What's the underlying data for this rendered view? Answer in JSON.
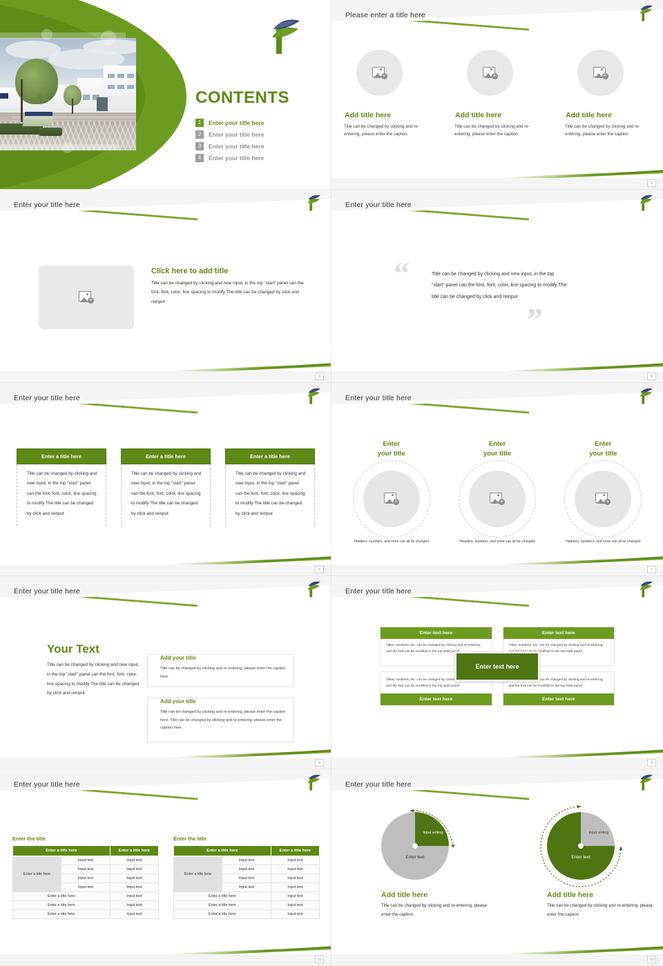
{
  "brand": {
    "green_dark": "#5d8a16",
    "green_mid": "#6c9c1f",
    "green_light": "#7aa72a",
    "navy": "#3c4a7a",
    "grey": "#c8c8c8",
    "logo_name": "leaf-sprout-logo"
  },
  "cover": {
    "title": "CONTENTS",
    "logo": "leaf-sprout-logo",
    "photo_alt": "campus-building-photo",
    "toc": [
      {
        "num": "1",
        "label": "Enter your title here",
        "active": true
      },
      {
        "num": "2",
        "label": "Enter your title here",
        "active": false
      },
      {
        "num": "3",
        "label": "Enter your title here",
        "active": false
      },
      {
        "num": "4",
        "label": "Enter your title here",
        "active": false
      }
    ]
  },
  "slide2": {
    "header_title": "Please enter a title here",
    "page_number": "5",
    "columns": [
      {
        "title": "Add title here",
        "body": "Title can be changed by clicking and re-entering, please enter the caption"
      },
      {
        "title": "Add title here",
        "body": "Title can be changed by clicking and re-entering, please enter the caption"
      },
      {
        "title": "Add title here",
        "body": "Title can be changed by clicking and re-entering, please enter the caption"
      }
    ]
  },
  "slide3": {
    "header_title": "Enter your title here",
    "page_number": "4",
    "title": "Click here to add title",
    "body": "Title can be changed by clicking and new input, in the top \"start\" panel can the font, font, color, line spacing to modify The title can be changed by click and reinput"
  },
  "slide4": {
    "header_title": "Enter your title here",
    "page_number": "5",
    "quote_open": "“",
    "quote_close": "”",
    "body": "Title can be changed by clicking and new input, in the top \"start\" panel can the font, font, color, line spacing to modify The title can be changed by click and reinput"
  },
  "slide5": {
    "header_title": "Enter your title here",
    "page_number": "6",
    "cards": [
      {
        "head": "Enter a title here",
        "body": "Title can be changed by clicking and new input, in the top \"start\" panel can the font, font, color, line spacing to modify The title can be changed by click and reinput"
      },
      {
        "head": "Enter a title here",
        "body": "Title can be changed by clicking and new input, in the top \"start\" panel can the font, font, color, line spacing to modify The title can be changed by click and reinput"
      },
      {
        "head": "Enter a title here",
        "body": "Title can be changed by clicking and new input, in the top \"start\" panel can the font, font, color, line spacing to modify The title can be changed by click and reinput"
      }
    ]
  },
  "slide6": {
    "header_title": "Enter your title here",
    "page_number": "7",
    "columns": [
      {
        "title_line1": "Enter",
        "title_line2": "your title",
        "caption": "Headers, numbers, and more can all be changed"
      },
      {
        "title_line1": "Enter",
        "title_line2": "your title",
        "caption": "Headers, numbers, and more can all be changed"
      },
      {
        "title_line1": "Enter",
        "title_line2": "your title",
        "caption": "Headers, numbers, and more can all be changed"
      }
    ]
  },
  "slide7": {
    "header_title": "Enter your title here",
    "page_number": "8",
    "left_title": "Your Text",
    "left_body": "Title can be changed by clicking and new input, in the top \"start\" panel can the font, font, color, line spacing to modify The title can be changed by click and reinput",
    "cards": [
      {
        "title": "Add your title",
        "body": "Title can be changed by clicking and re-entering, please enter the caption here."
      },
      {
        "title": "Add your title",
        "body": "Title can be changed by clicking and re-entering, please enter the caption here. Title can be changed by clicking and re-entering, please enter the caption here."
      }
    ]
  },
  "slide8": {
    "header_title": "Enter your title here",
    "page_number": "9",
    "center_label": "Enter text here",
    "quadrants": [
      {
        "head": "Enter text here",
        "body": "Titles, numbers, etc. can be changed by clicking and re-entering, and the font can be modified in the top Start panel.",
        "head_position": "top"
      },
      {
        "head": "Enter text here",
        "body": "Titles, numbers, etc. can be changed by clicking and re-entering, and the font can be modified in the top Start panel.",
        "head_position": "top"
      },
      {
        "head": "Enter text here",
        "body": "Titles, numbers, etc. can be changed by clicking and re-entering, and the font can be modified in the top Start panel.",
        "head_position": "bottom"
      },
      {
        "head": "Enter text here",
        "body": "Titles, numbers, etc. can be changed by clicking and re-entering, and the font can be modified in the top Start panel.",
        "head_position": "bottom"
      }
    ]
  },
  "slide9": {
    "header_title": "Enter your title here",
    "page_number": "13",
    "tables": [
      {
        "caption": "Enter the title",
        "headers": [
          "Enter a title here",
          "Enter a title here"
        ],
        "merged_row_label": "Enter a title here",
        "merged_rows": [
          [
            "Input text",
            "Input text"
          ],
          [
            "Input text",
            "Input text"
          ],
          [
            "Input text",
            "Input text"
          ],
          [
            "Input text",
            "Input text"
          ]
        ],
        "footer_rows": [
          [
            "Enter a title here",
            "Input text"
          ],
          [
            "Enter a title here",
            "Input text"
          ],
          [
            "Enter a title here",
            "Input text"
          ]
        ]
      },
      {
        "caption": "Enter the title",
        "headers": [
          "Enter a title here",
          "Enter a title here"
        ],
        "merged_row_label": "Enter a title here",
        "merged_rows": [
          [
            "Input text",
            "Input text"
          ],
          [
            "Input text",
            "Input text"
          ],
          [
            "Input text",
            "Input text"
          ],
          [
            "Input text",
            "Input text"
          ]
        ],
        "footer_rows": [
          [
            "Enter a title here",
            "Input text"
          ],
          [
            "Enter a title here",
            "Input text"
          ],
          [
            "Enter a title here",
            "Input text"
          ]
        ]
      }
    ]
  },
  "slide10": {
    "header_title": "Enter your title here",
    "page_number": "15",
    "charts": [
      {
        "slice_label": "input writing",
        "base_label": "Enter text",
        "title": "Add title here",
        "body": "Title can be changed by clicking and re-entering, please enter the caption"
      },
      {
        "slice_label": "input writing",
        "base_label": "Enter text",
        "title": "Add title here",
        "body": "Title can be changed by clicking and re-entering, please enter the caption"
      }
    ]
  },
  "chart_data": [
    {
      "type": "pie",
      "title": "Add title here",
      "labels": [
        "input writing",
        "Enter text"
      ],
      "values": [
        25,
        75
      ],
      "colors": [
        "#4f7512",
        "#bebebe"
      ],
      "start_angle": 0,
      "legend": "none",
      "annotation": "dotted arc arrow spans the green 25% slice"
    },
    {
      "type": "pie",
      "title": "Add title here",
      "labels": [
        "input writing",
        "Enter text"
      ],
      "values": [
        25,
        75
      ],
      "colors": [
        "#bebebe",
        "#4f7512"
      ],
      "start_angle": 0,
      "legend": "none",
      "annotation": "dotted arc arrow spans the green 75% slice"
    }
  ]
}
